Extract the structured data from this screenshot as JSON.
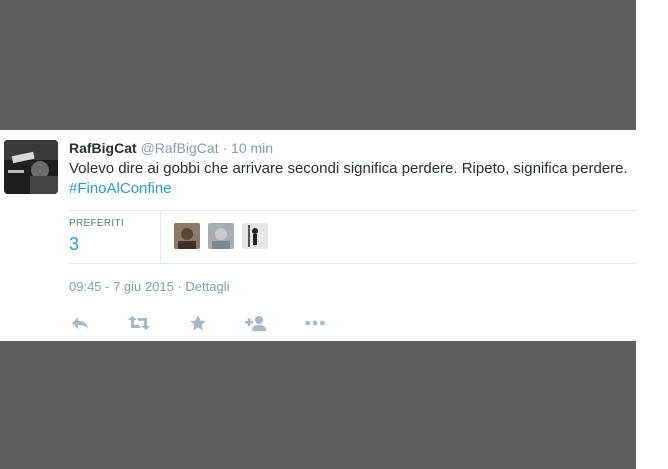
{
  "tweet": {
    "author": {
      "name": "RafBigCat",
      "handle": "@RafBigCat",
      "avatar_icon": "user-avatar"
    },
    "separator": "·",
    "time_ago": "10 min",
    "text_before": "Volevo dire ai gobbi che arrivare secondi significa perdere. Ripeto, significa perdere. ",
    "hashtag": "#FinoAlConfine",
    "stats": {
      "favorites_label": "PREFERITI",
      "favorites_count": "3"
    },
    "favoriters": [
      {
        "icon": "favoriter-avatar"
      },
      {
        "icon": "favoriter-avatar"
      },
      {
        "icon": "favoriter-avatar"
      }
    ],
    "timestamp": "09:45 - 7 giu 2015",
    "details_separator": "·",
    "details_link": "Dettagli",
    "actions": [
      {
        "icon": "reply-icon"
      },
      {
        "icon": "retweet-icon"
      },
      {
        "icon": "favorite-star-icon"
      },
      {
        "icon": "follow-user-icon"
      },
      {
        "icon": "more-options-icon"
      }
    ]
  },
  "colors": {
    "backdrop": "#5f5f5f",
    "link": "#2b9bd0",
    "text": "#292f33",
    "muted": "#8899a6",
    "icon": "#aab8c2"
  }
}
